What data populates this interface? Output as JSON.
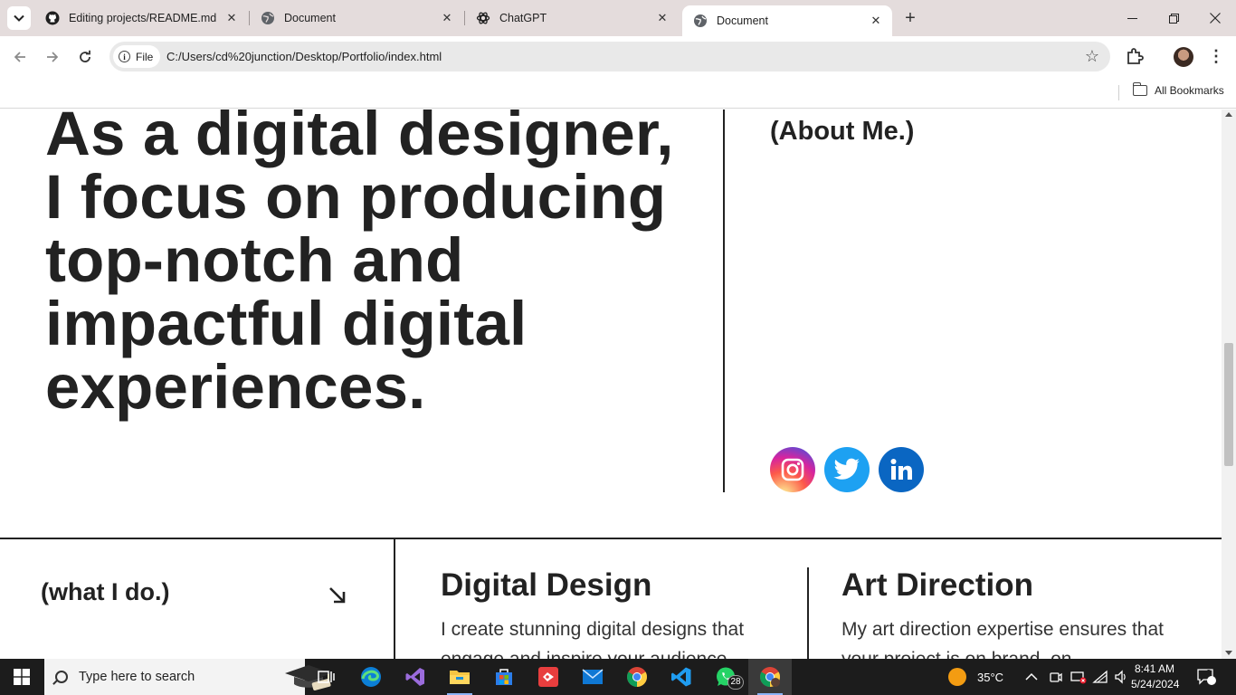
{
  "browser": {
    "tabs": [
      {
        "title": "Editing projects/README.md at",
        "icon": "github-icon",
        "active": false
      },
      {
        "title": "Document",
        "icon": "globe-icon",
        "active": false
      },
      {
        "title": "ChatGPT",
        "icon": "chatgpt-icon",
        "active": false
      },
      {
        "title": "Document",
        "icon": "globe-icon",
        "active": true
      }
    ],
    "close_glyph": "✕",
    "new_tab_glyph": "+",
    "window": {
      "minimize": "—",
      "restore": "❐",
      "close": "✕"
    },
    "toolbar": {
      "back": "←",
      "forward": "→",
      "reload": "↻",
      "scheme_chip": "File",
      "url": "C:/Users/cd%20junction/Desktop/Portfolio/index.html",
      "bookmark_star": "☆",
      "menu": "⋮"
    },
    "bookmarks": {
      "all_bookmarks": "All Bookmarks"
    }
  },
  "page": {
    "hero_text": "As a digital designer, I focus on producing top-notch and impactful digital experiences.",
    "about_label": "(About Me.)",
    "socials": [
      {
        "name": "Instagram",
        "icon": "instagram-icon",
        "color": "#d62976"
      },
      {
        "name": "Twitter",
        "icon": "twitter-icon",
        "color": "#1da1f2"
      },
      {
        "name": "LinkedIn",
        "icon": "linkedin-icon",
        "color": "#0a66c2"
      }
    ],
    "what_i_do_label": "(what I do.)",
    "services": [
      {
        "title": "Digital Design",
        "desc": "I create stunning digital designs that engage and inspire your audience."
      },
      {
        "title": "Art Direction",
        "desc": "My art direction expertise ensures that your project is on brand, on"
      }
    ]
  },
  "taskbar": {
    "search_placeholder": "Type here to search",
    "apps": [
      {
        "name": "Task View",
        "icon": "task-view-icon"
      },
      {
        "name": "Microsoft Edge",
        "icon": "edge-icon"
      },
      {
        "name": "Visual Studio",
        "icon": "visual-studio-icon"
      },
      {
        "name": "File Explorer",
        "icon": "file-explorer-icon"
      },
      {
        "name": "Microsoft Store",
        "icon": "store-icon"
      },
      {
        "name": "Git app",
        "icon": "git-icon"
      },
      {
        "name": "Mail",
        "icon": "mail-icon"
      },
      {
        "name": "Google Chrome",
        "icon": "chrome-icon"
      },
      {
        "name": "VS Code",
        "icon": "vscode-icon"
      },
      {
        "name": "WhatsApp",
        "icon": "whatsapp-icon",
        "badge": "28"
      },
      {
        "name": "Chrome profile",
        "icon": "chrome-profile-icon",
        "active": true
      }
    ],
    "weather": "35°C",
    "time": "8:41 AM",
    "date": "5/24/2024",
    "notifications": "2"
  }
}
